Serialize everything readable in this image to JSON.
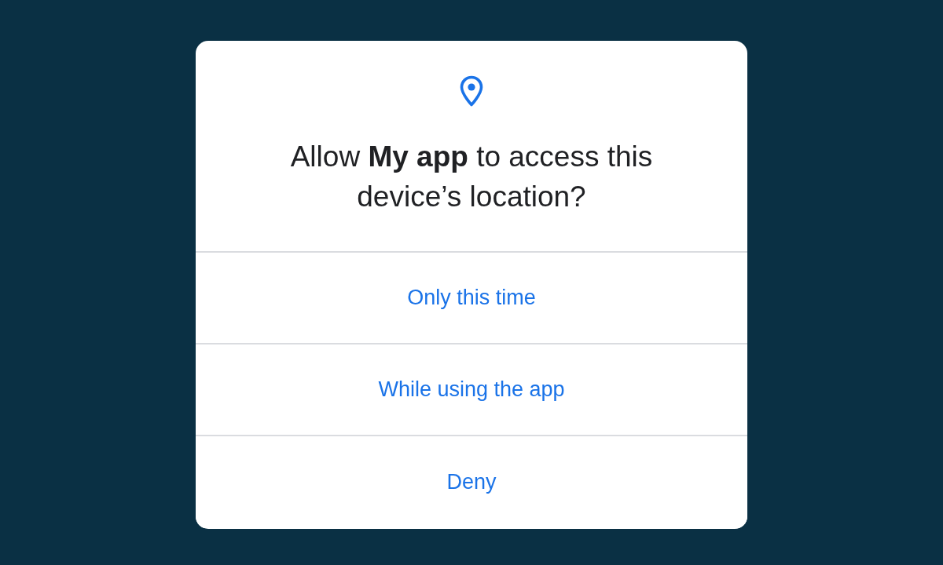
{
  "dialog": {
    "title": "Allow **My app** to access this device’s location?",
    "buttons": [
      {
        "label": "Only this time"
      },
      {
        "label": "While using the app"
      },
      {
        "label": "Deny"
      }
    ]
  }
}
